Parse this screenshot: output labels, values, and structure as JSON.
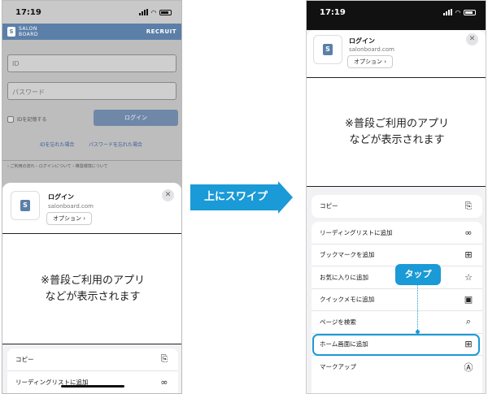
{
  "left_phone": {
    "status": {
      "time": "17:19"
    },
    "web": {
      "logo_line1": "SALON",
      "logo_line2": "BOARD",
      "brand": "RECRUIT",
      "id_placeholder": "ID",
      "password_placeholder": "パスワード",
      "remember_label": "IDを記憶する",
      "login_button": "ログイン",
      "forgot_id": "IDを忘れた場合",
      "forgot_password": "パスワードを忘れた場合",
      "footer_links": "› ご利用の流れ  › ログインについて  › 推奨環境について"
    },
    "sheet": {
      "title": "ログイン",
      "url": "salonboard.com",
      "options": "オプション ›",
      "close": "✕",
      "preview_line1": "※普段ご利用のアプリ",
      "preview_line2": "などが表示されます",
      "actions": [
        {
          "label": "コピー",
          "icon": "copy-icon",
          "glyph": "⎘"
        },
        {
          "label": "リーディングリストに追加",
          "icon": "glasses-icon",
          "glyph": "∞"
        }
      ]
    }
  },
  "right_phone": {
    "status": {
      "time": "17:19"
    },
    "sheet": {
      "title": "ログイン",
      "url": "salonboard.com",
      "options": "オプション ›",
      "close": "✕",
      "preview_line1": "※普段ご利用のアプリ",
      "preview_line2": "などが表示されます",
      "copy": {
        "label": "コピー",
        "icon": "copy-icon",
        "glyph": "⎘"
      },
      "actions": [
        {
          "label": "リーディングリストに追加",
          "icon": "glasses-icon",
          "glyph": "∞"
        },
        {
          "label": "ブックマークを追加",
          "icon": "book-icon",
          "glyph": "⊞"
        },
        {
          "label": "お気に入りに追加",
          "icon": "star-icon",
          "glyph": "☆"
        },
        {
          "label": "クイックメモに追加",
          "icon": "memo-icon",
          "glyph": "▣"
        },
        {
          "label": "ページを検索",
          "icon": "search-page-icon",
          "glyph": "⌕"
        },
        {
          "label": "ホーム画面に追加",
          "icon": "add-square-icon",
          "glyph": "⊞"
        },
        {
          "label": "マークアップ",
          "icon": "markup-icon",
          "glyph": "Ⓐ"
        }
      ]
    }
  },
  "annotations": {
    "swipe": "上にスワイプ",
    "tap": "タップ"
  },
  "colors": {
    "accent": "#1a9ad6",
    "brand": "#5b7fa8"
  }
}
